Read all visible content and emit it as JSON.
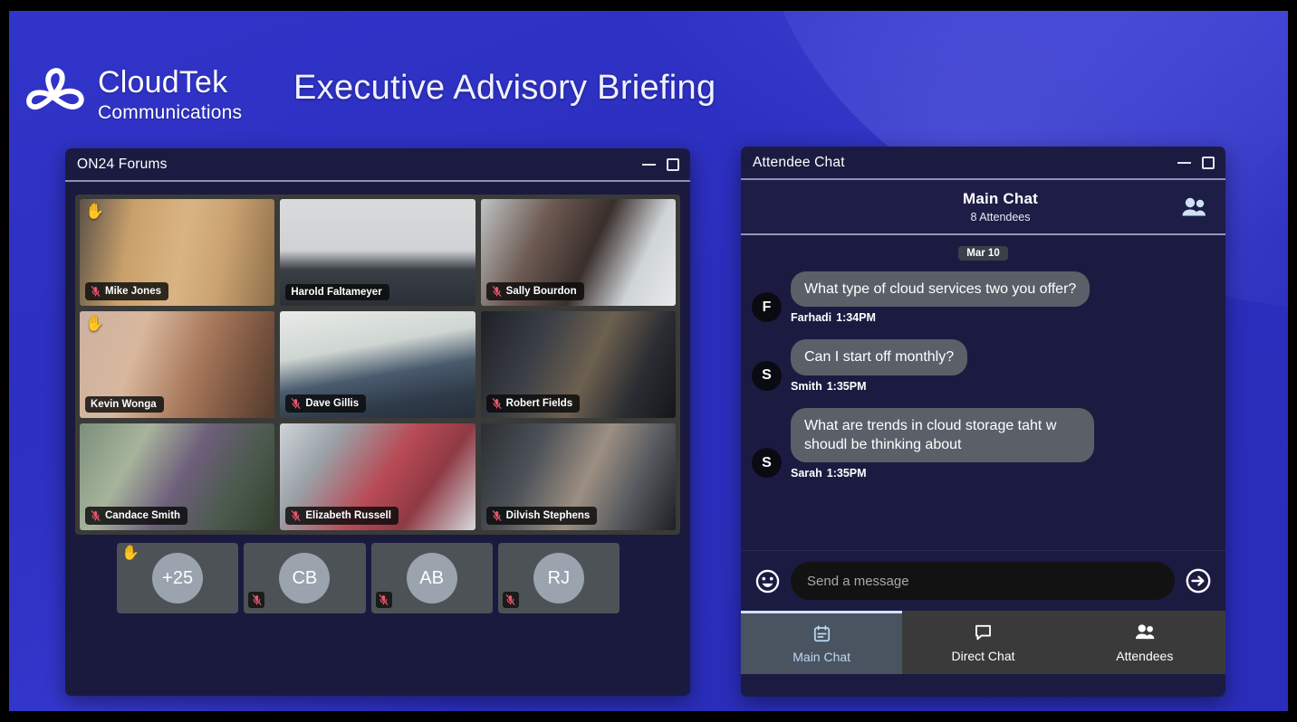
{
  "brand": {
    "name": "CloudTek",
    "sub": "Communications",
    "logo_icon": "trefoil-knot-logo"
  },
  "event": {
    "title": "Executive Advisory Briefing"
  },
  "colors": {
    "background_blue": "#2c2fc2",
    "panel_navy": "#1b1b42",
    "active_speaker_orange": "#f0a030",
    "bubble_gray": "#5b6068",
    "tab_active_blue": "#bcd8f5",
    "mic_muted_red": "#e8556e"
  },
  "forums_panel": {
    "title": "ON24 Forums",
    "minimize_icon": "minimize-icon",
    "maximize_icon": "maximize-icon",
    "participants": [
      {
        "name": "Mike Jones",
        "muted": true,
        "hand_raised": true,
        "speaking": false
      },
      {
        "name": "Harold Faltameyer",
        "muted": false,
        "hand_raised": false,
        "speaking": false
      },
      {
        "name": "Sally Bourdon",
        "muted": true,
        "hand_raised": false,
        "speaking": false
      },
      {
        "name": "Kevin Wonga",
        "muted": false,
        "hand_raised": true,
        "speaking": true
      },
      {
        "name": "Dave Gillis",
        "muted": true,
        "hand_raised": false,
        "speaking": false
      },
      {
        "name": "Robert Fields",
        "muted": true,
        "hand_raised": false,
        "speaking": false
      },
      {
        "name": "Candace Smith",
        "muted": true,
        "hand_raised": false,
        "speaking": false
      },
      {
        "name": "Elizabeth Russell",
        "muted": true,
        "hand_raised": false,
        "speaking": false
      },
      {
        "name": "Dilvish Stephens",
        "muted": true,
        "hand_raised": false,
        "speaking": false
      }
    ],
    "avatars": [
      {
        "initials": "+25",
        "muted": false,
        "hand_raised": true
      },
      {
        "initials": "CB",
        "muted": true,
        "hand_raised": false
      },
      {
        "initials": "AB",
        "muted": true,
        "hand_raised": false
      },
      {
        "initials": "RJ",
        "muted": true,
        "hand_raised": false
      }
    ]
  },
  "chat_panel": {
    "title": "Attendee Chat",
    "minimize_icon": "minimize-icon",
    "maximize_icon": "maximize-icon",
    "room_title": "Main Chat",
    "attendee_count": "8 Attendees",
    "people_icon": "people-icon",
    "date_divider": "Mar 10",
    "messages": [
      {
        "initial": "F",
        "text": "What type of cloud services two you offer?",
        "author": "Farhadi",
        "time": "1:34PM"
      },
      {
        "initial": "S",
        "text": "Can I start off monthly?",
        "author": "Smith",
        "time": "1:35PM"
      },
      {
        "initial": "S",
        "text": "What are trends in cloud storage taht w shoudl be thinking about",
        "author": "Sarah",
        "time": "1:35PM"
      }
    ],
    "composer": {
      "emoji_icon": "emoji-smiley-icon",
      "placeholder": "Send a message",
      "value": "",
      "send_icon": "send-arrow-icon"
    },
    "tabs": [
      {
        "label": "Main Chat",
        "icon": "calendar-notes-icon",
        "active": true
      },
      {
        "label": "Direct Chat",
        "icon": "speech-bubble-icon",
        "active": false
      },
      {
        "label": "Attendees",
        "icon": "people-icon",
        "active": false
      }
    ]
  }
}
